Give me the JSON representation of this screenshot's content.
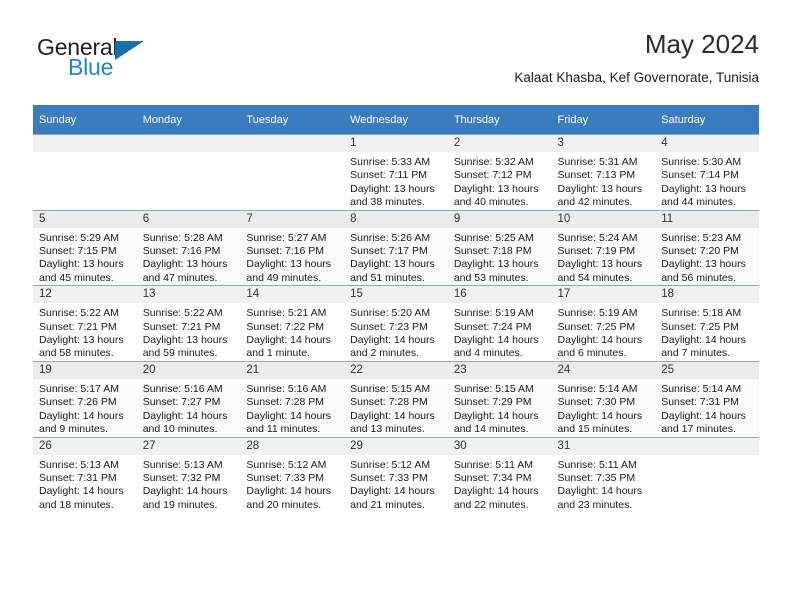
{
  "brand": {
    "word1": "General",
    "word2": "Blue",
    "triangle_color": "#1b6cb0",
    "word2_color": "#2484c6"
  },
  "header": {
    "title": "May 2024",
    "subtitle": "Kalaat Khasba, Kef Governorate, Tunisia"
  },
  "theme": {
    "header_row_bg": "#3a7cbe",
    "header_row_text": "#ffffff",
    "grid_line": "#8aa9c8",
    "daynum_bg": "#f1f1f1",
    "alt_row_bg": "#fafafa"
  },
  "weekday_headers": [
    "Sunday",
    "Monday",
    "Tuesday",
    "Wednesday",
    "Thursday",
    "Friday",
    "Saturday"
  ],
  "weeks": [
    [
      {
        "day": "",
        "sunrise": "",
        "sunset": "",
        "daylight1": "",
        "daylight2": ""
      },
      {
        "day": "",
        "sunrise": "",
        "sunset": "",
        "daylight1": "",
        "daylight2": ""
      },
      {
        "day": "",
        "sunrise": "",
        "sunset": "",
        "daylight1": "",
        "daylight2": ""
      },
      {
        "day": "1",
        "sunrise": "Sunrise: 5:33 AM",
        "sunset": "Sunset: 7:11 PM",
        "daylight1": "Daylight: 13 hours",
        "daylight2": "and 38 minutes."
      },
      {
        "day": "2",
        "sunrise": "Sunrise: 5:32 AM",
        "sunset": "Sunset: 7:12 PM",
        "daylight1": "Daylight: 13 hours",
        "daylight2": "and 40 minutes."
      },
      {
        "day": "3",
        "sunrise": "Sunrise: 5:31 AM",
        "sunset": "Sunset: 7:13 PM",
        "daylight1": "Daylight: 13 hours",
        "daylight2": "and 42 minutes."
      },
      {
        "day": "4",
        "sunrise": "Sunrise: 5:30 AM",
        "sunset": "Sunset: 7:14 PM",
        "daylight1": "Daylight: 13 hours",
        "daylight2": "and 44 minutes."
      }
    ],
    [
      {
        "day": "5",
        "sunrise": "Sunrise: 5:29 AM",
        "sunset": "Sunset: 7:15 PM",
        "daylight1": "Daylight: 13 hours",
        "daylight2": "and 45 minutes."
      },
      {
        "day": "6",
        "sunrise": "Sunrise: 5:28 AM",
        "sunset": "Sunset: 7:16 PM",
        "daylight1": "Daylight: 13 hours",
        "daylight2": "and 47 minutes."
      },
      {
        "day": "7",
        "sunrise": "Sunrise: 5:27 AM",
        "sunset": "Sunset: 7:16 PM",
        "daylight1": "Daylight: 13 hours",
        "daylight2": "and 49 minutes."
      },
      {
        "day": "8",
        "sunrise": "Sunrise: 5:26 AM",
        "sunset": "Sunset: 7:17 PM",
        "daylight1": "Daylight: 13 hours",
        "daylight2": "and 51 minutes."
      },
      {
        "day": "9",
        "sunrise": "Sunrise: 5:25 AM",
        "sunset": "Sunset: 7:18 PM",
        "daylight1": "Daylight: 13 hours",
        "daylight2": "and 53 minutes."
      },
      {
        "day": "10",
        "sunrise": "Sunrise: 5:24 AM",
        "sunset": "Sunset: 7:19 PM",
        "daylight1": "Daylight: 13 hours",
        "daylight2": "and 54 minutes."
      },
      {
        "day": "11",
        "sunrise": "Sunrise: 5:23 AM",
        "sunset": "Sunset: 7:20 PM",
        "daylight1": "Daylight: 13 hours",
        "daylight2": "and 56 minutes."
      }
    ],
    [
      {
        "day": "12",
        "sunrise": "Sunrise: 5:22 AM",
        "sunset": "Sunset: 7:21 PM",
        "daylight1": "Daylight: 13 hours",
        "daylight2": "and 58 minutes."
      },
      {
        "day": "13",
        "sunrise": "Sunrise: 5:22 AM",
        "sunset": "Sunset: 7:21 PM",
        "daylight1": "Daylight: 13 hours",
        "daylight2": "and 59 minutes."
      },
      {
        "day": "14",
        "sunrise": "Sunrise: 5:21 AM",
        "sunset": "Sunset: 7:22 PM",
        "daylight1": "Daylight: 14 hours",
        "daylight2": "and 1 minute."
      },
      {
        "day": "15",
        "sunrise": "Sunrise: 5:20 AM",
        "sunset": "Sunset: 7:23 PM",
        "daylight1": "Daylight: 14 hours",
        "daylight2": "and 2 minutes."
      },
      {
        "day": "16",
        "sunrise": "Sunrise: 5:19 AM",
        "sunset": "Sunset: 7:24 PM",
        "daylight1": "Daylight: 14 hours",
        "daylight2": "and 4 minutes."
      },
      {
        "day": "17",
        "sunrise": "Sunrise: 5:19 AM",
        "sunset": "Sunset: 7:25 PM",
        "daylight1": "Daylight: 14 hours",
        "daylight2": "and 6 minutes."
      },
      {
        "day": "18",
        "sunrise": "Sunrise: 5:18 AM",
        "sunset": "Sunset: 7:25 PM",
        "daylight1": "Daylight: 14 hours",
        "daylight2": "and 7 minutes."
      }
    ],
    [
      {
        "day": "19",
        "sunrise": "Sunrise: 5:17 AM",
        "sunset": "Sunset: 7:26 PM",
        "daylight1": "Daylight: 14 hours",
        "daylight2": "and 9 minutes."
      },
      {
        "day": "20",
        "sunrise": "Sunrise: 5:16 AM",
        "sunset": "Sunset: 7:27 PM",
        "daylight1": "Daylight: 14 hours",
        "daylight2": "and 10 minutes."
      },
      {
        "day": "21",
        "sunrise": "Sunrise: 5:16 AM",
        "sunset": "Sunset: 7:28 PM",
        "daylight1": "Daylight: 14 hours",
        "daylight2": "and 11 minutes."
      },
      {
        "day": "22",
        "sunrise": "Sunrise: 5:15 AM",
        "sunset": "Sunset: 7:28 PM",
        "daylight1": "Daylight: 14 hours",
        "daylight2": "and 13 minutes."
      },
      {
        "day": "23",
        "sunrise": "Sunrise: 5:15 AM",
        "sunset": "Sunset: 7:29 PM",
        "daylight1": "Daylight: 14 hours",
        "daylight2": "and 14 minutes."
      },
      {
        "day": "24",
        "sunrise": "Sunrise: 5:14 AM",
        "sunset": "Sunset: 7:30 PM",
        "daylight1": "Daylight: 14 hours",
        "daylight2": "and 15 minutes."
      },
      {
        "day": "25",
        "sunrise": "Sunrise: 5:14 AM",
        "sunset": "Sunset: 7:31 PM",
        "daylight1": "Daylight: 14 hours",
        "daylight2": "and 17 minutes."
      }
    ],
    [
      {
        "day": "26",
        "sunrise": "Sunrise: 5:13 AM",
        "sunset": "Sunset: 7:31 PM",
        "daylight1": "Daylight: 14 hours",
        "daylight2": "and 18 minutes."
      },
      {
        "day": "27",
        "sunrise": "Sunrise: 5:13 AM",
        "sunset": "Sunset: 7:32 PM",
        "daylight1": "Daylight: 14 hours",
        "daylight2": "and 19 minutes."
      },
      {
        "day": "28",
        "sunrise": "Sunrise: 5:12 AM",
        "sunset": "Sunset: 7:33 PM",
        "daylight1": "Daylight: 14 hours",
        "daylight2": "and 20 minutes."
      },
      {
        "day": "29",
        "sunrise": "Sunrise: 5:12 AM",
        "sunset": "Sunset: 7:33 PM",
        "daylight1": "Daylight: 14 hours",
        "daylight2": "and 21 minutes."
      },
      {
        "day": "30",
        "sunrise": "Sunrise: 5:11 AM",
        "sunset": "Sunset: 7:34 PM",
        "daylight1": "Daylight: 14 hours",
        "daylight2": "and 22 minutes."
      },
      {
        "day": "31",
        "sunrise": "Sunrise: 5:11 AM",
        "sunset": "Sunset: 7:35 PM",
        "daylight1": "Daylight: 14 hours",
        "daylight2": "and 23 minutes."
      },
      {
        "day": "",
        "sunrise": "",
        "sunset": "",
        "daylight1": "",
        "daylight2": ""
      }
    ]
  ]
}
